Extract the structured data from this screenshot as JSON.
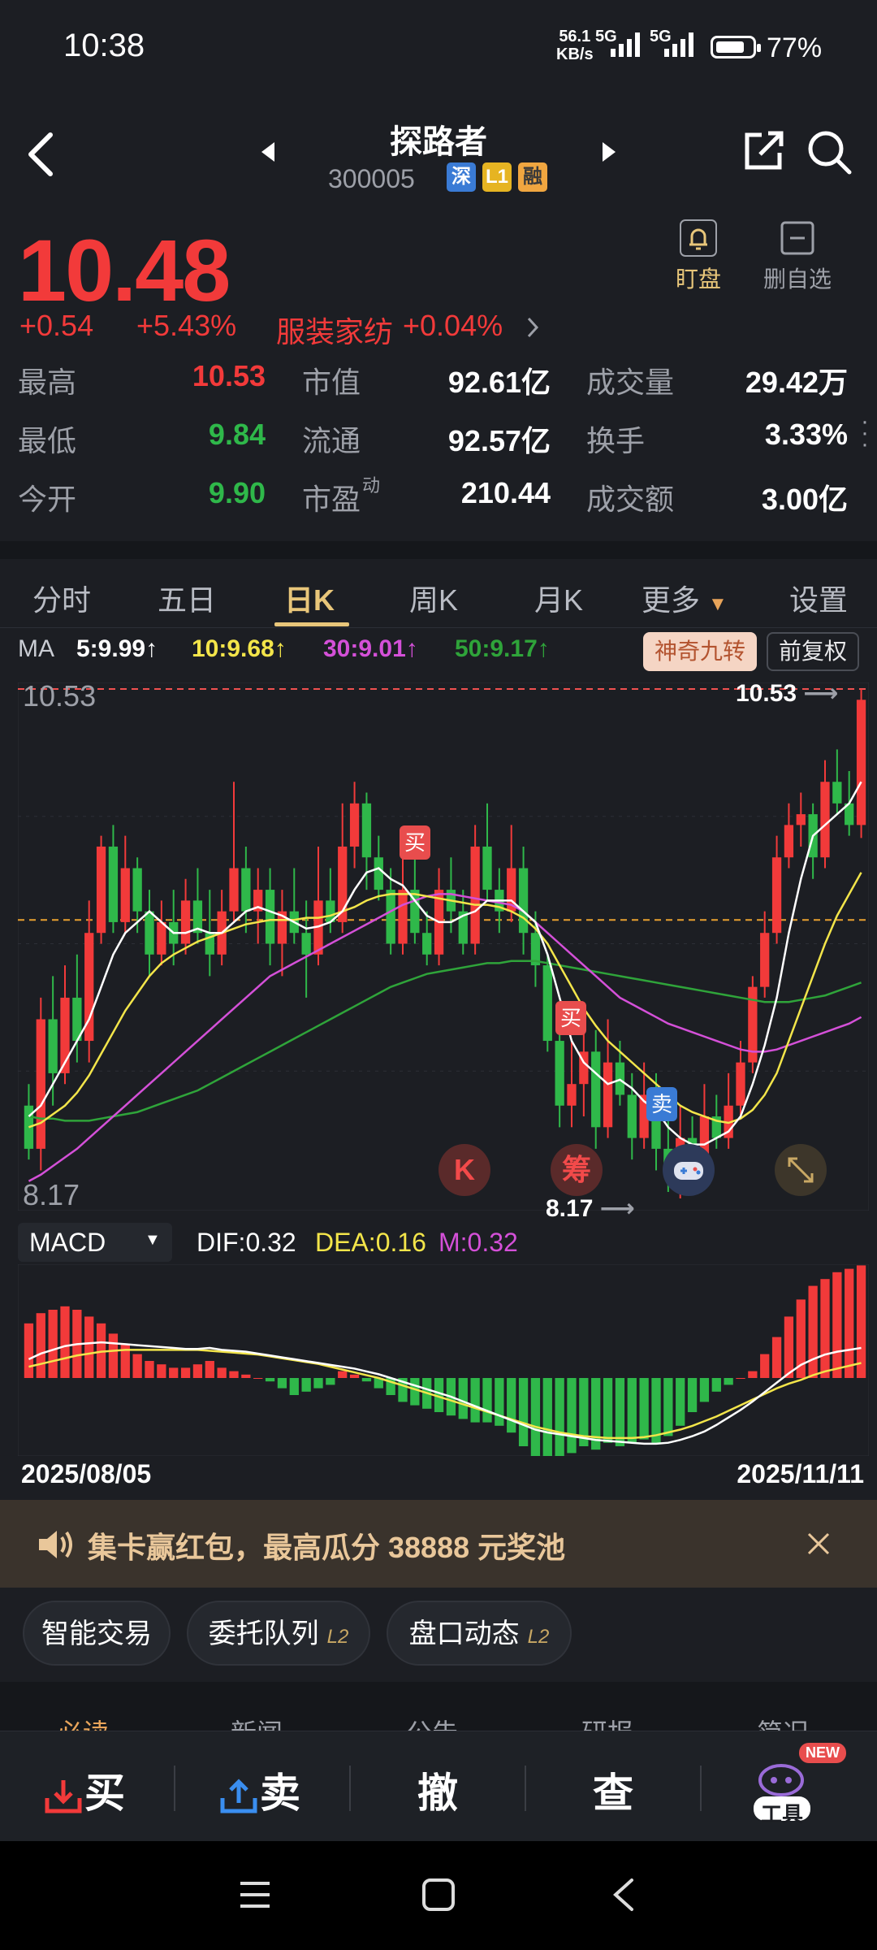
{
  "status": {
    "time": "10:38",
    "net_speed": "56.1",
    "net_unit": "KB/s",
    "sig1": "5G",
    "sig2": "5G",
    "battery": "77%"
  },
  "header": {
    "title": "探路者",
    "code": "300005",
    "tags": [
      "深",
      "L1",
      "融"
    ]
  },
  "quote": {
    "price": "10.48",
    "change": "+0.54",
    "change_pct": "+5.43%",
    "sector": "服装家纺",
    "sector_pct": "+0.04%"
  },
  "actions": {
    "watch": "盯盘",
    "remove": "删自选"
  },
  "stats": [
    {
      "l1": "最高",
      "v1": "10.53",
      "l2": "市值",
      "v2": "92.61亿",
      "l3": "成交量",
      "v3": "29.42万"
    },
    {
      "l1": "最低",
      "v1": "9.84",
      "l2": "流通",
      "v2": "92.57亿",
      "l3": "换手",
      "v3": "3.33%"
    },
    {
      "l1": "今开",
      "v1": "9.90",
      "l2": "市盈",
      "l2sup": "动",
      "v2": "210.44",
      "l3": "成交额",
      "v3": "3.00亿"
    }
  ],
  "tabs": [
    "分时",
    "五日",
    "日K",
    "周K",
    "月K",
    "更多",
    "设置"
  ],
  "ma": {
    "label": "MA",
    "ma5": "5:9.99↑",
    "ma10": "10:9.68↑",
    "ma30": "30:9.01↑",
    "ma50": "50:9.17↑",
    "chip1": "神奇九转",
    "chip2": "前复权"
  },
  "chart": {
    "ymax": "10.53",
    "ymin": "8.17",
    "high_note": "10.53",
    "low_note": "8.17",
    "buy": "买",
    "sell": "卖",
    "k_btn": "K",
    "chou_btn": "筹"
  },
  "macd": {
    "label": "MACD",
    "dif": "DIF:0.32",
    "dea": "DEA:0.16",
    "m": "M:0.32"
  },
  "dates": {
    "start": "2025/08/05",
    "end": "2025/11/11"
  },
  "banner": {
    "text": "集卡赢红包，最高瓜分 38888 元奖池"
  },
  "pills": [
    {
      "label": "智能交易",
      "sup": ""
    },
    {
      "label": "委托队列",
      "sup": "L2"
    },
    {
      "label": "盘口动态",
      "sup": "L2"
    }
  ],
  "news_tabs": [
    "必读",
    "新闻",
    "公告",
    "研报",
    "简况"
  ],
  "bottom": {
    "buy": "买",
    "sell": "卖",
    "cancel": "撤",
    "query": "查",
    "tools": "工具",
    "new": "NEW"
  },
  "colors": {
    "up": "#f23a3a",
    "down": "#2fb84a",
    "ma5": "#ffffff",
    "ma10": "#f3e54a",
    "ma30": "#d450d8",
    "ma50": "#2fa43a",
    "accent": "#e8c67a"
  },
  "chart_data": {
    "type": "candlestick",
    "ylim": [
      8.17,
      10.53
    ],
    "candles": [
      [
        8.6,
        8.4,
        8.7,
        8.35
      ],
      [
        8.4,
        9.0,
        9.1,
        8.3
      ],
      [
        9.0,
        8.75,
        9.2,
        8.6
      ],
      [
        8.75,
        9.1,
        9.25,
        8.7
      ],
      [
        9.1,
        8.9,
        9.3,
        8.8
      ],
      [
        8.9,
        9.4,
        9.55,
        8.8
      ],
      [
        9.4,
        9.8,
        9.85,
        9.35
      ],
      [
        9.8,
        9.45,
        9.9,
        9.4
      ],
      [
        9.45,
        9.7,
        9.85,
        9.4
      ],
      [
        9.7,
        9.5,
        9.75,
        9.4
      ],
      [
        9.5,
        9.3,
        9.6,
        9.2
      ],
      [
        9.3,
        9.45,
        9.55,
        9.25
      ],
      [
        9.45,
        9.35,
        9.6,
        9.25
      ],
      [
        9.35,
        9.55,
        9.65,
        9.3
      ],
      [
        9.55,
        9.4,
        9.7,
        9.35
      ],
      [
        9.4,
        9.3,
        9.6,
        9.2
      ],
      [
        9.3,
        9.5,
        9.6,
        9.25
      ],
      [
        9.5,
        9.7,
        10.1,
        9.45
      ],
      [
        9.7,
        9.5,
        9.8,
        9.4
      ],
      [
        9.5,
        9.6,
        9.7,
        9.35
      ],
      [
        9.6,
        9.35,
        9.7,
        9.25
      ],
      [
        9.35,
        9.5,
        9.6,
        9.2
      ],
      [
        9.5,
        9.4,
        9.7,
        9.35
      ],
      [
        9.4,
        9.3,
        9.55,
        9.1
      ],
      [
        9.3,
        9.55,
        9.8,
        9.25
      ],
      [
        9.55,
        9.45,
        9.7,
        9.4
      ],
      [
        9.45,
        9.8,
        10.0,
        9.4
      ],
      [
        9.8,
        10.0,
        10.1,
        9.7
      ],
      [
        10.0,
        9.75,
        10.05,
        9.6
      ],
      [
        9.75,
        9.6,
        9.85,
        9.55
      ],
      [
        9.6,
        9.35,
        9.7,
        9.3
      ],
      [
        9.35,
        9.6,
        9.75,
        9.3
      ],
      [
        9.6,
        9.4,
        9.8,
        9.35
      ],
      [
        9.4,
        9.3,
        9.5,
        9.25
      ],
      [
        9.3,
        9.6,
        9.7,
        9.25
      ],
      [
        9.6,
        9.5,
        9.75,
        9.4
      ],
      [
        9.5,
        9.35,
        9.6,
        9.3
      ],
      [
        9.35,
        9.8,
        9.9,
        9.3
      ],
      [
        9.8,
        9.6,
        10.0,
        9.55
      ],
      [
        9.6,
        9.5,
        9.7,
        9.4
      ],
      [
        9.5,
        9.7,
        9.9,
        9.45
      ],
      [
        9.7,
        9.4,
        9.8,
        9.3
      ],
      [
        9.4,
        9.25,
        9.5,
        9.15
      ],
      [
        9.25,
        8.9,
        9.3,
        8.85
      ],
      [
        8.9,
        8.6,
        9.0,
        8.5
      ],
      [
        8.6,
        8.7,
        8.9,
        8.5
      ],
      [
        8.7,
        8.85,
        9.05,
        8.55
      ],
      [
        8.85,
        8.5,
        8.95,
        8.4
      ],
      [
        8.5,
        8.8,
        9.0,
        8.45
      ],
      [
        8.8,
        8.65,
        8.9,
        8.6
      ],
      [
        8.65,
        8.45,
        8.75,
        8.35
      ],
      [
        8.45,
        8.65,
        8.8,
        8.4
      ],
      [
        8.65,
        8.4,
        8.75,
        8.3
      ],
      [
        8.4,
        8.3,
        8.55,
        8.2
      ],
      [
        8.3,
        8.45,
        8.6,
        8.17
      ],
      [
        8.45,
        8.35,
        8.55,
        8.25
      ],
      [
        8.35,
        8.55,
        8.7,
        8.3
      ],
      [
        8.55,
        8.45,
        8.65,
        8.4
      ],
      [
        8.45,
        8.6,
        8.75,
        8.4
      ],
      [
        8.6,
        8.8,
        8.9,
        8.55
      ],
      [
        8.8,
        9.15,
        9.2,
        8.75
      ],
      [
        9.15,
        9.4,
        9.5,
        9.1
      ],
      [
        9.4,
        9.75,
        9.85,
        9.35
      ],
      [
        9.75,
        9.9,
        10.0,
        9.7
      ],
      [
        9.9,
        9.95,
        10.05,
        9.8
      ],
      [
        9.95,
        9.75,
        10.0,
        9.65
      ],
      [
        9.75,
        10.1,
        10.2,
        9.7
      ],
      [
        10.1,
        10.0,
        10.25,
        9.95
      ],
      [
        10.0,
        9.9,
        10.15,
        9.85
      ],
      [
        9.9,
        10.48,
        10.53,
        9.84
      ]
    ],
    "ma5": [
      8.55,
      8.6,
      8.7,
      8.8,
      8.9,
      9.0,
      9.15,
      9.3,
      9.4,
      9.45,
      9.5,
      9.45,
      9.4,
      9.4,
      9.42,
      9.4,
      9.4,
      9.45,
      9.5,
      9.52,
      9.5,
      9.48,
      9.45,
      9.42,
      9.43,
      9.45,
      9.5,
      9.6,
      9.68,
      9.7,
      9.65,
      9.62,
      9.55,
      9.48,
      9.45,
      9.45,
      9.48,
      9.5,
      9.55,
      9.55,
      9.55,
      9.5,
      9.45,
      9.3,
      9.1,
      8.9,
      8.8,
      8.75,
      8.7,
      8.72,
      8.68,
      8.62,
      8.58,
      8.5,
      8.45,
      8.42,
      8.42,
      8.45,
      8.48,
      8.55,
      8.7,
      8.88,
      9.1,
      9.4,
      9.65,
      9.85,
      9.9,
      9.95,
      10.0,
      10.1
    ],
    "ma10": [
      8.5,
      8.52,
      8.56,
      8.6,
      8.66,
      8.74,
      8.84,
      8.94,
      9.04,
      9.12,
      9.2,
      9.26,
      9.3,
      9.33,
      9.36,
      9.38,
      9.4,
      9.42,
      9.44,
      9.45,
      9.46,
      9.46,
      9.46,
      9.47,
      9.47,
      9.48,
      9.5,
      9.52,
      9.55,
      9.57,
      9.58,
      9.58,
      9.58,
      9.57,
      9.56,
      9.55,
      9.54,
      9.53,
      9.53,
      9.52,
      9.5,
      9.47,
      9.42,
      9.35,
      9.25,
      9.15,
      9.05,
      8.97,
      8.9,
      8.85,
      8.8,
      8.75,
      8.7,
      8.65,
      8.6,
      8.57,
      8.55,
      8.53,
      8.52,
      8.54,
      8.58,
      8.65,
      8.75,
      8.9,
      9.05,
      9.2,
      9.35,
      9.48,
      9.58,
      9.68
    ],
    "ma30": [
      8.25,
      8.28,
      8.32,
      8.36,
      8.4,
      8.45,
      8.5,
      8.55,
      8.6,
      8.65,
      8.7,
      8.75,
      8.8,
      8.85,
      8.9,
      8.95,
      9.0,
      9.05,
      9.1,
      9.15,
      9.2,
      9.23,
      9.26,
      9.29,
      9.32,
      9.35,
      9.38,
      9.41,
      9.44,
      9.47,
      9.5,
      9.53,
      9.55,
      9.57,
      9.58,
      9.58,
      9.57,
      9.56,
      9.55,
      9.54,
      9.53,
      9.5,
      9.45,
      9.4,
      9.35,
      9.3,
      9.25,
      9.2,
      9.15,
      9.1,
      9.07,
      9.04,
      9.01,
      8.98,
      8.96,
      8.94,
      8.92,
      8.9,
      8.88,
      8.86,
      8.85,
      8.85,
      8.86,
      8.88,
      8.9,
      8.92,
      8.94,
      8.96,
      8.98,
      9.01
    ],
    "ma50": [
      8.55,
      8.54,
      8.54,
      8.53,
      8.53,
      8.53,
      8.54,
      8.55,
      8.56,
      8.57,
      8.59,
      8.61,
      8.63,
      8.65,
      8.67,
      8.7,
      8.73,
      8.76,
      8.79,
      8.82,
      8.85,
      8.88,
      8.91,
      8.94,
      8.97,
      9.0,
      9.03,
      9.06,
      9.09,
      9.12,
      9.15,
      9.17,
      9.19,
      9.21,
      9.22,
      9.23,
      9.24,
      9.25,
      9.26,
      9.26,
      9.27,
      9.27,
      9.27,
      9.26,
      9.25,
      9.24,
      9.23,
      9.22,
      9.21,
      9.2,
      9.19,
      9.18,
      9.17,
      9.16,
      9.15,
      9.14,
      9.13,
      9.12,
      9.11,
      9.1,
      9.09,
      9.08,
      9.08,
      9.08,
      9.09,
      9.1,
      9.11,
      9.13,
      9.15,
      9.17
    ],
    "macd_m": [
      0.32,
      0.38,
      0.4,
      0.42,
      0.4,
      0.36,
      0.32,
      0.26,
      0.2,
      0.14,
      0.1,
      0.08,
      0.06,
      0.06,
      0.08,
      0.1,
      0.06,
      0.04,
      0.02,
      0.0,
      -0.02,
      -0.06,
      -0.1,
      -0.08,
      -0.06,
      -0.04,
      0.04,
      0.02,
      -0.02,
      -0.06,
      -0.1,
      -0.14,
      -0.16,
      -0.18,
      -0.2,
      -0.22,
      -0.24,
      -0.26,
      -0.26,
      -0.28,
      -0.32,
      -0.4,
      -0.5,
      -0.52,
      -0.48,
      -0.44,
      -0.4,
      -0.42,
      -0.38,
      -0.4,
      -0.38,
      -0.36,
      -0.38,
      -0.34,
      -0.28,
      -0.2,
      -0.14,
      -0.08,
      -0.04,
      0.0,
      0.04,
      0.14,
      0.24,
      0.36,
      0.46,
      0.54,
      0.58,
      0.62,
      0.64,
      0.66
    ],
    "macd_dif": [
      0.2,
      0.26,
      0.3,
      0.34,
      0.36,
      0.37,
      0.38,
      0.37,
      0.36,
      0.35,
      0.34,
      0.33,
      0.32,
      0.31,
      0.31,
      0.32,
      0.3,
      0.29,
      0.28,
      0.26,
      0.24,
      0.22,
      0.2,
      0.18,
      0.16,
      0.14,
      0.12,
      0.1,
      0.07,
      0.04,
      0.0,
      -0.04,
      -0.08,
      -0.12,
      -0.16,
      -0.2,
      -0.25,
      -0.3,
      -0.35,
      -0.4,
      -0.45,
      -0.5,
      -0.55,
      -0.58,
      -0.6,
      -0.62,
      -0.64,
      -0.66,
      -0.67,
      -0.68,
      -0.69,
      -0.7,
      -0.7,
      -0.69,
      -0.66,
      -0.62,
      -0.57,
      -0.5,
      -0.42,
      -0.34,
      -0.25,
      -0.15,
      -0.05,
      0.05,
      0.14,
      0.2,
      0.25,
      0.28,
      0.3,
      0.32
    ],
    "macd_dea": [
      0.12,
      0.15,
      0.18,
      0.21,
      0.24,
      0.26,
      0.28,
      0.29,
      0.3,
      0.3,
      0.3,
      0.3,
      0.3,
      0.3,
      0.3,
      0.29,
      0.28,
      0.27,
      0.26,
      0.25,
      0.23,
      0.21,
      0.19,
      0.17,
      0.15,
      0.12,
      0.09,
      0.06,
      0.03,
      0.0,
      -0.04,
      -0.08,
      -0.12,
      -0.16,
      -0.2,
      -0.24,
      -0.28,
      -0.32,
      -0.36,
      -0.4,
      -0.44,
      -0.48,
      -0.52,
      -0.55,
      -0.58,
      -0.6,
      -0.62,
      -0.63,
      -0.64,
      -0.64,
      -0.64,
      -0.63,
      -0.61,
      -0.58,
      -0.55,
      -0.51,
      -0.46,
      -0.41,
      -0.35,
      -0.29,
      -0.23,
      -0.17,
      -0.11,
      -0.06,
      -0.02,
      0.03,
      0.07,
      0.1,
      0.13,
      0.16
    ]
  }
}
